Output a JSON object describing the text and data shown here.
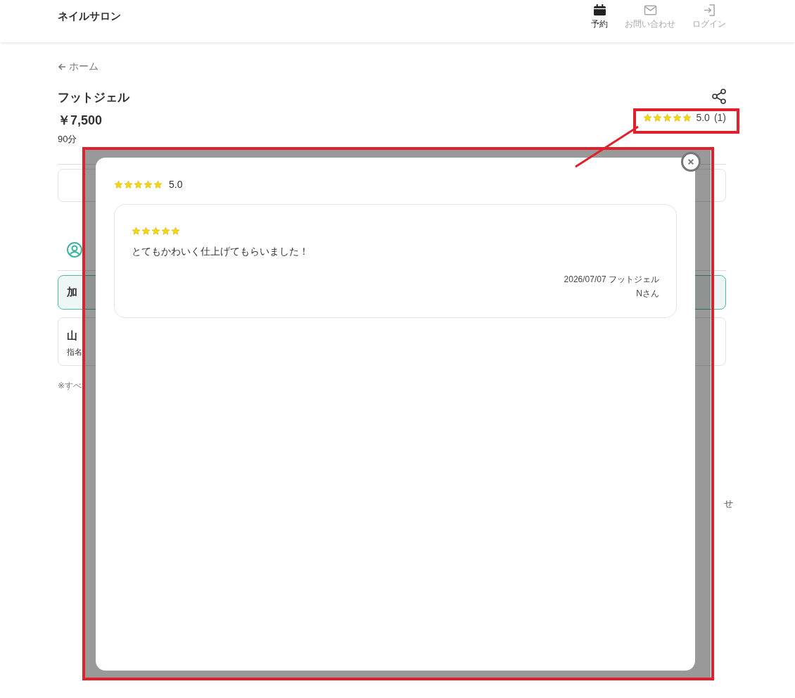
{
  "header": {
    "logo": "ネイルサロン",
    "nav": [
      {
        "kind": "calendar",
        "label": "予約",
        "selected": true
      },
      {
        "kind": "mail",
        "label": "お問い合わせ",
        "selected": false
      },
      {
        "kind": "login",
        "label": "ログイン",
        "selected": false
      }
    ]
  },
  "back_link": "ホーム",
  "menu": {
    "title": "フットジェル",
    "price": "￥7,500",
    "duration": "90分",
    "rating": {
      "stars": 5,
      "score": "5.0",
      "count": "(1)"
    }
  },
  "background_fragments": {
    "staff_selected": "加",
    "staff_name": "山",
    "nominate": "指名",
    "note": "※すべ",
    "right_text": "せ"
  },
  "review_modal": {
    "summary": {
      "stars": 5,
      "score": "5.0"
    },
    "reviews": [
      {
        "stars": 5,
        "text": "とてもかわいく仕上げてもらいました！",
        "meta": "2026/07/07 フットジェル",
        "author": "Nさん"
      }
    ]
  }
}
